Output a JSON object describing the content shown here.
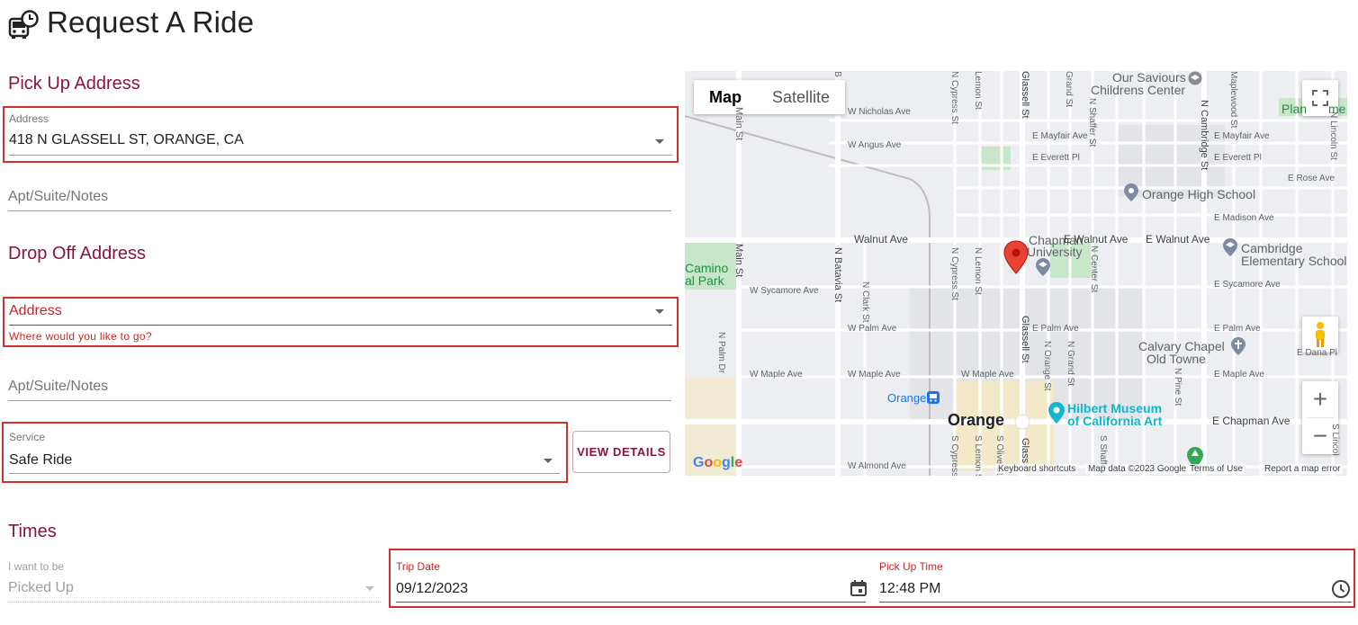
{
  "page": {
    "title": "Request A Ride"
  },
  "pickup": {
    "section_title": "Pick Up Address",
    "address_label": "Address",
    "address_value": "418 N GLASSELL ST, ORANGE, CA",
    "notes_placeholder": "Apt/Suite/Notes"
  },
  "dropoff": {
    "section_title": "Drop Off Address",
    "address_label": "Address",
    "address_helper": "Where would you like to go?",
    "notes_placeholder": "Apt/Suite/Notes"
  },
  "service": {
    "label": "Service",
    "value": "Safe Ride",
    "details_button": "VIEW DETAILS"
  },
  "times": {
    "section_title": "Times",
    "want_label": "I want to be",
    "want_value": "Picked Up",
    "date_label": "Trip Date",
    "date_value": "09/12/2023",
    "time_label": "Pick Up Time",
    "time_value": "12:48 PM"
  },
  "map": {
    "type_map": "Map",
    "type_satellite": "Satellite",
    "city_label": "Orange",
    "transit_label": "Orange",
    "poi": {
      "saviours_1": "Our Saviours",
      "saviours_2": "Childrens Center",
      "plan": "Plan",
      "me": "me",
      "ohs": "Orange High School",
      "chapman_1": "Chapman",
      "chapman_2": "University",
      "cambridge_1": "Cambridge",
      "cambridge_2": "Elementary School",
      "calvary_1": "Calvary Chapel",
      "calvary_2": "Old Towne",
      "hilbert_1": "Hilbert Museum",
      "hilbert_2": "of California Art",
      "camino_1": "Camino",
      "camino_2": "al Park"
    },
    "streets": {
      "nicholas": "W Nicholas Ave",
      "angus": "W Angus Ave",
      "mayfair": "E Mayfair Ave",
      "mayfair2": "E Mayfair Ave",
      "everett": "E Everett Pl",
      "everett2": "E Everett Pl",
      "rose": "E Rose Ave",
      "madison": "E Madison Ave",
      "walnut_w": "Walnut Ave",
      "walnut_e1": "E Walnut Ave",
      "walnut_e2": "E Walnut Ave",
      "sycamore_w": "W Sycamore Ave",
      "sycamore_e": "E Sycamore Ave",
      "palm_w": "W Palm Ave",
      "palm_e": "E Palm Ave",
      "palm_e2": "E Palm Ave",
      "dana": "E Dana Pl",
      "maple_w1": "W Maple Ave",
      "maple_w2": "W Maple Ave",
      "maple_w3": "W Maple Ave",
      "maple_e": "E Maple Ave",
      "chapman_ave": "E Chapman Ave",
      "almond": "W Almond Ave",
      "main": "Main St",
      "batavia": "N Batavia St",
      "clark": "N Clark St",
      "cypress": "N Cypress St",
      "cypress2": "N Cypress St",
      "lemon": "Lemon St",
      "lemon2": "N Lemon St",
      "glassell": "Glassell St",
      "glassell2": "Glassell St",
      "glassell3": "Glass",
      "grand": "Grand St",
      "shaffer": "N Shaffer St",
      "cambridge_st": "N Cambridge St",
      "maplewood": "Maplewood St",
      "lincoln": "N Lincoln St",
      "center": "N Center St",
      "orange_st": "N Orange St",
      "grand2": "N Grand St",
      "pine": "N Pine St",
      "palm_dr": "N Palm Dr",
      "olive": "S Olive St",
      "lemon_s": "S Lemon St",
      "cypress_s": "S Cypress",
      "shaffer_s": "S Shaffe",
      "lincoln_s": "S Lincol",
      "b_st": "B"
    },
    "footer": {
      "keyboard": "Keyboard shortcuts",
      "mapdata": "Map data ©2023 Google",
      "terms": "Terms of Use",
      "report": "Report a map error",
      "google": "Google"
    },
    "colors": {
      "road": "#ffffff",
      "park": "#c8e6c9",
      "water": "#aadaff",
      "marker": "#ea4335"
    }
  }
}
